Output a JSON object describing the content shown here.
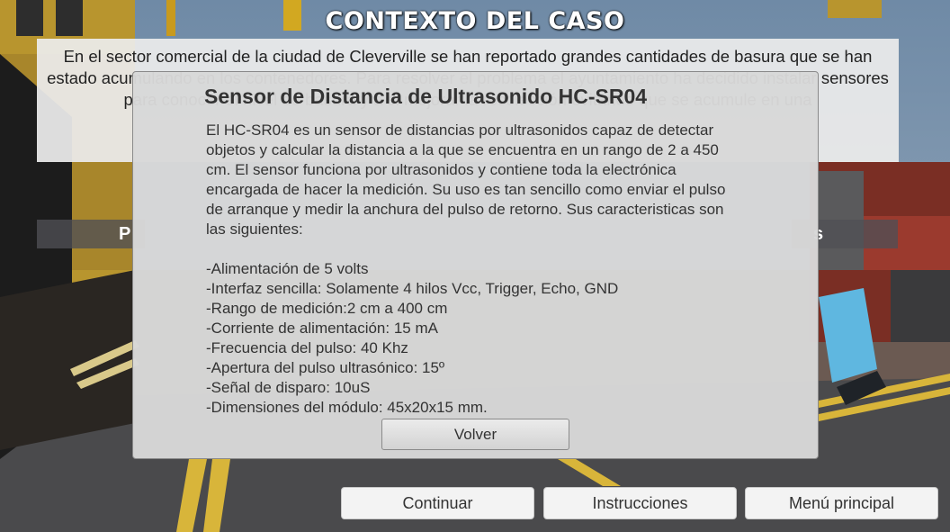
{
  "title": "CONTEXTO DEL CASO",
  "context": {
    "text": "En el sector comercial de la ciudad de Cleverville se han reportado grandes cantidades de basura que se han estado acumulando en los contenedores. Para resolver el problema el ayuntamiento ha decidido instalar sensores para conocer el nivel de basura y a si mejorar la recolección evitando que se acumule en una"
  },
  "side_labels": {
    "left": "P",
    "right": "s"
  },
  "modal": {
    "title": "Sensor de Distancia de Ultrasonido HC-SR04",
    "intro": "El HC-SR04 es un sensor de distancias por ultrasonidos capaz de detectar objetos y calcular la distancia a la que se encuentra en un rango de 2 a 450 cm. El sensor funciona por ultrasonidos y contiene toda la electrónica encargada de hacer la medición. Su uso es tan sencillo como enviar el pulso de arranque y medir la anchura del pulso de retorno. Sus caracteristicas son las siguientes:",
    "specs": [
      "-Alimentación de 5 volts",
      "-Interfaz sencilla: Solamente 4 hilos Vcc, Trigger, Echo, GND",
      "-Rango de medición:2 cm a 400 cm",
      "-Corriente de alimentación: 15 mA",
      "-Frecuencia del pulso: 40 Khz",
      "-Apertura del pulso ultrasónico: 15º",
      "-Señal de disparo: 10uS",
      "-Dimensiones del módulo: 45x20x15 mm."
    ],
    "close_label": "Volver"
  },
  "buttons": {
    "continue_label": "Continuar",
    "instructions_label": "Instrucciones",
    "main_menu_label": "Menú principal"
  }
}
